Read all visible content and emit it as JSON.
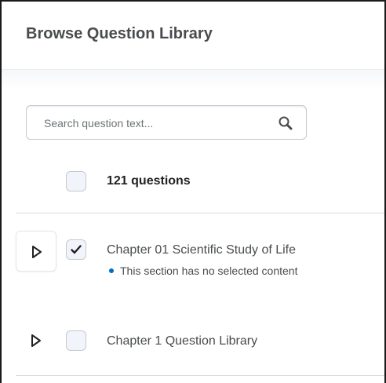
{
  "header": {
    "title": "Browse Question Library"
  },
  "search": {
    "placeholder": "Search question text...",
    "value": ""
  },
  "selection": {
    "count_label": "121 questions"
  },
  "items": [
    {
      "title": "Chapter 01 Scientific Study of Life",
      "status": "This section has no selected content",
      "checked": true
    },
    {
      "title": "Chapter 1 Question Library",
      "status": "",
      "checked": false
    }
  ],
  "icons": {
    "search": "search-icon",
    "expand": "triangle-right-icon",
    "check": "checkmark-icon"
  },
  "colors": {
    "title_text": "#494c4e",
    "status_dot": "#006fbf",
    "checkbox_fill": "#f1f5fb",
    "divider": "#d9dcde"
  }
}
